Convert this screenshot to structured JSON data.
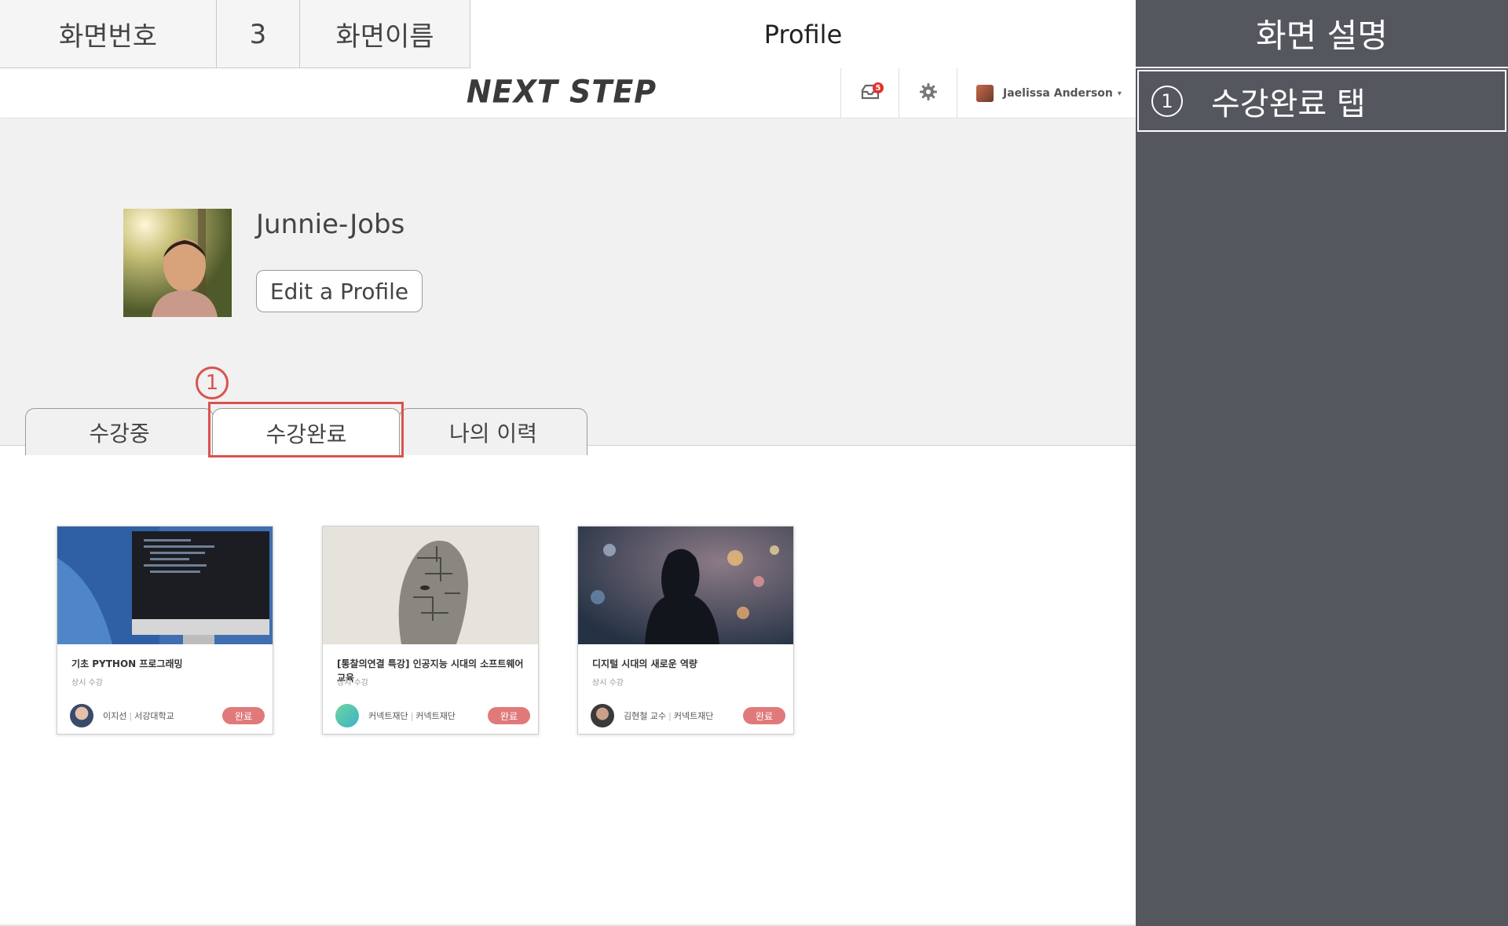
{
  "storyboard": {
    "screen_no_label": "화면번호",
    "screen_no": "3",
    "screen_name_label": "화면이름",
    "screen_name": "Profile",
    "desc_title": "화면 설명",
    "desc_items": [
      {
        "num": "1",
        "text": "수강완료 탭"
      }
    ],
    "marker": "1",
    "highlight_color": "#d9534f"
  },
  "navbar": {
    "logo": "NEXT STEP",
    "notification_count": "5",
    "user_name": "Jaelissa Anderson",
    "caret": "▾",
    "icons": [
      "inbox-icon",
      "gear-icon"
    ]
  },
  "profile": {
    "username": "Junnie-Jobs",
    "edit_button": "Edit a Profile"
  },
  "tabs": [
    {
      "label": "수강중",
      "active": false
    },
    {
      "label": "수강완료",
      "active": true
    },
    {
      "label": "나의 이력",
      "active": false
    }
  ],
  "courses": [
    {
      "title": "기초 PYTHON 프로그래밍",
      "subtitle": "상시 수강",
      "instructor": "이지선",
      "org": "서강대학교",
      "status": "완료"
    },
    {
      "title": "[통찰의연결 특강] 인공지능 시대의 소프트웨어 교육",
      "subtitle": "상시 수강",
      "instructor": "커넥트재단",
      "org": "커넥트재단",
      "status": "완료"
    },
    {
      "title": "디지털 시대의 새로운 역량",
      "subtitle": "상시 수강",
      "instructor": "김현철 교수",
      "org": "커넥트재단",
      "status": "완료"
    }
  ],
  "colors": {
    "panel": "#54575e",
    "status_badge": "#e07a7a",
    "badge_red": "#e0322c"
  }
}
